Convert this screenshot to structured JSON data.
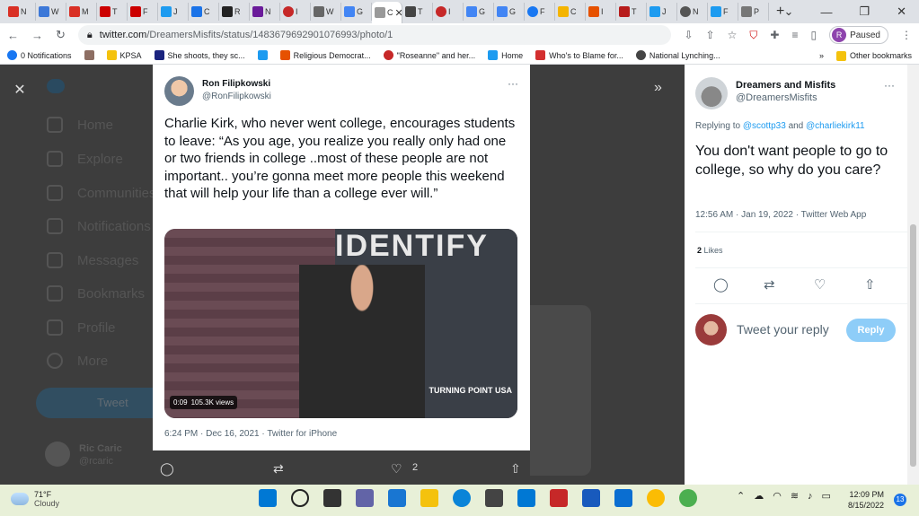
{
  "browser": {
    "tabs": [
      "N",
      "W",
      "M",
      "T",
      "F",
      "J",
      "C",
      "R",
      "N",
      "I",
      "W",
      "G",
      "C",
      "T",
      "I",
      "G",
      "G",
      "F",
      "C",
      "I",
      "T",
      "J",
      "N",
      "F",
      "P"
    ],
    "active_tab": "C",
    "url_host": "twitter.com",
    "url_path": "/DreamersMisfits/status/1483679692901076993/photo/1",
    "profile_status": "Paused",
    "profile_initial": "R",
    "bookmarks": [
      "0 Notifications",
      "KPSA",
      "She shoots, they sc...",
      "Religious Democrat...",
      "\"Roseanne\" and her...",
      "Home",
      "Who's to Blame for...",
      "National Lynching..."
    ],
    "other_bookmarks": "Other bookmarks"
  },
  "background_nav": [
    "Home",
    "Explore",
    "Communities",
    "Notifications",
    "Messages",
    "Bookmarks",
    "Profile",
    "More"
  ],
  "background_tweet_btn": "Tweet",
  "background_user": {
    "name": "Ric Caric",
    "handle": "@rcaric"
  },
  "center_tweet": {
    "author": "Ron Filipkowski",
    "handle": "@RonFilipkowski",
    "text": "Charlie Kirk, who never went college, encourages students to leave: “As you age, you realize you really only had one or two friends in college ..most of these people are not important.. you’re gonna meet more people this weekend that will help your life than a college ever will.”",
    "video_time": "0:09",
    "video_views": "105.3K views",
    "video_logo": "TURNING POINT USA",
    "video_word": "IDENTIFY",
    "meta": "6:24 PM · Dec 16, 2021 · Twitter for iPhone",
    "likes": "2"
  },
  "reply_tweet": {
    "author": "Dreamers and Misfits",
    "handle": "@DreamersMisfits",
    "replying_prefix": "Replying to",
    "replying_to_1": "@scottp33",
    "replying_and": "and",
    "replying_to_2": "@charliekirk11",
    "text": "You don't want people to go to college, so why do you care?",
    "meta": "12:56 AM · Jan 19, 2022 · Twitter Web App",
    "likes_count": "2",
    "likes_label": "Likes",
    "reply_placeholder": "Tweet your reply",
    "reply_button": "Reply"
  },
  "taskbar": {
    "temp": "71°F",
    "weather": "Cloudy",
    "time": "12:09 PM",
    "date": "8/15/2022",
    "notifications": "13"
  },
  "colors": {
    "twitter_blue": "#1d9bf0",
    "reply_btn_disabled": "#8ecdf8"
  }
}
